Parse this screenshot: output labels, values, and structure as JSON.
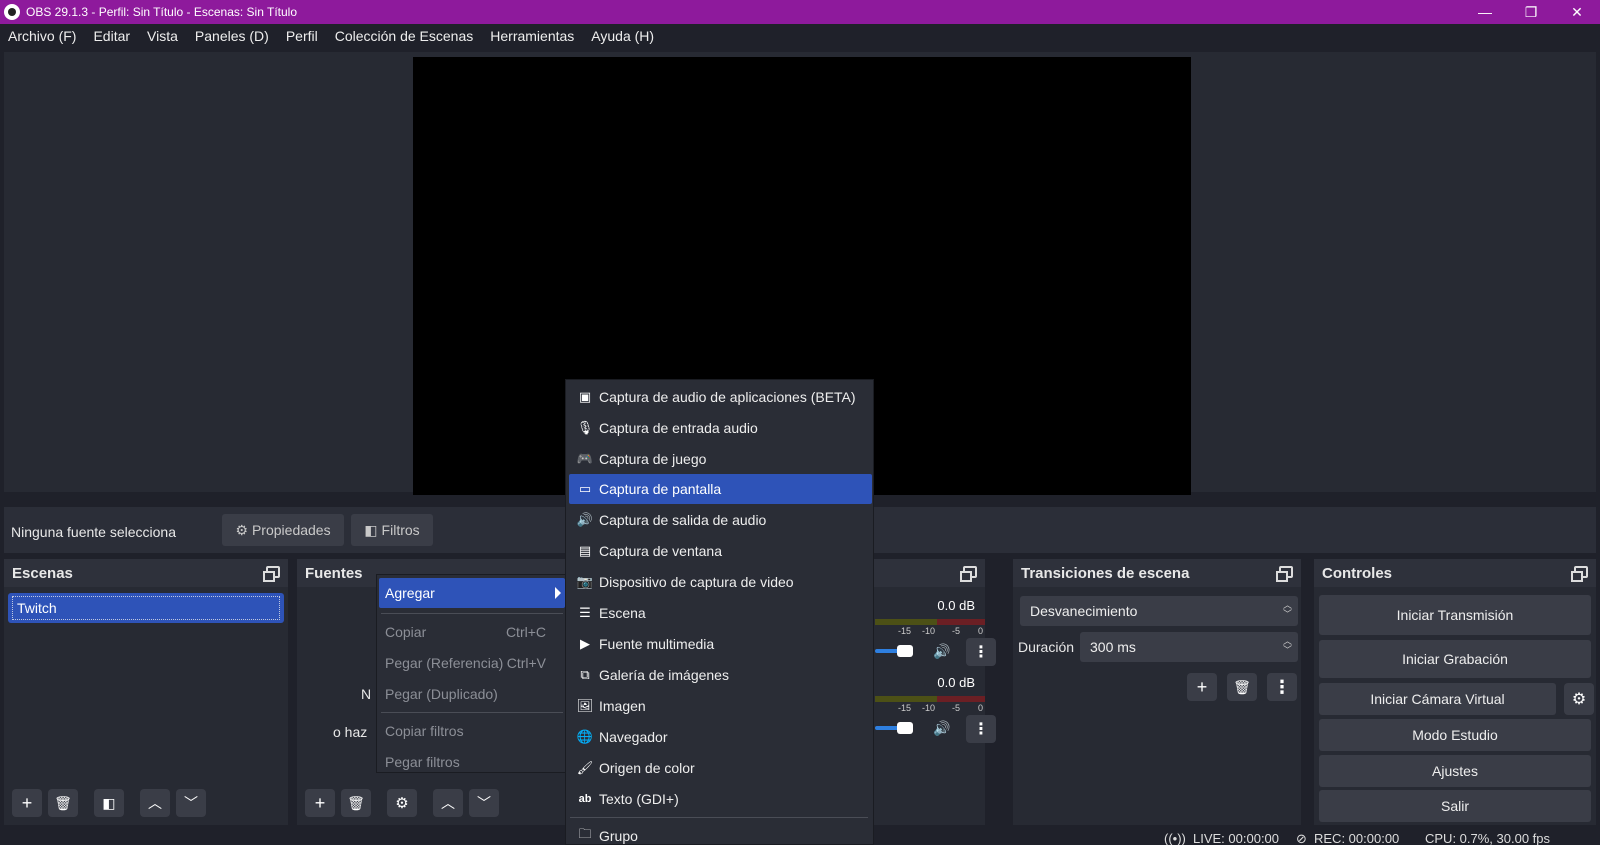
{
  "window": {
    "title": "OBS 29.1.3 - Perfil: Sin Título - Escenas: Sin Título",
    "minimize": "—",
    "restore": "❐",
    "close": "✕"
  },
  "menu": [
    "Archivo (F)",
    "Editar",
    "Vista",
    "Paneles (D)",
    "Perfil",
    "Colección de Escenas",
    "Herramientas",
    "Ayuda (H)"
  ],
  "source_bar": {
    "no_selection": "Ninguna fuente selecciona",
    "properties": "Propiedades",
    "filters": "Filtros"
  },
  "scenes": {
    "title": "Escenas",
    "items": [
      "Twitch"
    ]
  },
  "sources": {
    "title": "Fuentes",
    "hint_1": "N",
    "hint_2": "o haz"
  },
  "mixer": {
    "tracks": [
      {
        "db": "0.0 dB"
      },
      {
        "db": "0.0 dB"
      }
    ],
    "ticks": [
      "-15",
      "-10",
      "-5",
      "0"
    ]
  },
  "transitions": {
    "title": "Transiciones de escena",
    "selected": "Desvanecimiento",
    "duration_label": "Duración",
    "duration_value": "300 ms"
  },
  "controls": {
    "title": "Controles",
    "start_stream": "Iniciar Transmisión",
    "start_recording": "Iniciar Grabación",
    "start_virtual_cam": "Iniciar Cámara Virtual",
    "studio_mode": "Modo Estudio",
    "settings": "Ajustes",
    "exit": "Salir"
  },
  "status": {
    "live": "LIVE: 00:00:00",
    "rec": "REC: 00:00:00",
    "cpu": "CPU: 0.7%, 30.00 fps"
  },
  "context_menu": {
    "add": "Agregar",
    "copy": "Copiar",
    "copy_sc": "Ctrl+C",
    "paste_ref": "Pegar (Referencia)",
    "paste_ref_sc": "Ctrl+V",
    "paste_dup": "Pegar (Duplicado)",
    "copy_filters": "Copiar filtros",
    "paste_filters": "Pegar filtros"
  },
  "add_submenu": [
    {
      "label": "Captura de audio de aplicaciones (BETA)",
      "icon": "app-audio-icon"
    },
    {
      "label": "Captura de entrada audio",
      "icon": "microphone-icon"
    },
    {
      "label": "Captura de juego",
      "icon": "gamepad-icon"
    },
    {
      "label": "Captura de pantalla",
      "icon": "monitor-icon"
    },
    {
      "label": "Captura de salida de audio",
      "icon": "speaker-icon"
    },
    {
      "label": "Captura de ventana",
      "icon": "window-icon"
    },
    {
      "label": "Dispositivo de captura de video",
      "icon": "camera-icon"
    },
    {
      "label": "Escena",
      "icon": "list-icon"
    },
    {
      "label": "Fuente multimedia",
      "icon": "play-icon"
    },
    {
      "label": "Galería de imágenes",
      "icon": "slideshow-icon"
    },
    {
      "label": "Imagen",
      "icon": "image-icon"
    },
    {
      "label": "Navegador",
      "icon": "globe-icon"
    },
    {
      "label": "Origen de color",
      "icon": "brush-icon"
    },
    {
      "label": "Texto (GDI+)",
      "icon": "text-icon"
    },
    {
      "label": "Grupo",
      "icon": "folder-icon"
    }
  ]
}
